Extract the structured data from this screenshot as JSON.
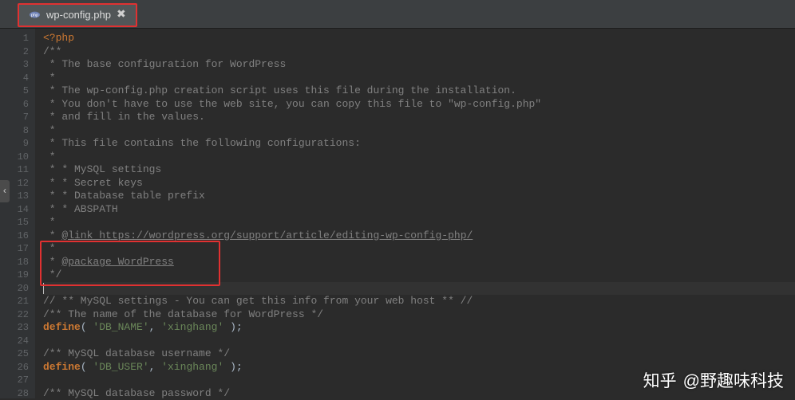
{
  "tab": {
    "filename": "wp-config.php",
    "close_glyph": "✖",
    "icon_name": "php-file-icon"
  },
  "lines": [
    {
      "n": 1,
      "segs": [
        {
          "t": "<?php",
          "cls": "c-tag"
        }
      ]
    },
    {
      "n": 2,
      "segs": [
        {
          "t": "/**",
          "cls": "c-comment"
        }
      ]
    },
    {
      "n": 3,
      "segs": [
        {
          "t": " * The base configuration for WordPress",
          "cls": "c-comment"
        }
      ]
    },
    {
      "n": 4,
      "segs": [
        {
          "t": " *",
          "cls": "c-comment"
        }
      ]
    },
    {
      "n": 5,
      "segs": [
        {
          "t": " * The wp-config.php creation script uses this file during the installation.",
          "cls": "c-comment"
        }
      ]
    },
    {
      "n": 6,
      "segs": [
        {
          "t": " * You don't have to use the web site, you can copy this file to \"wp-config.php\"",
          "cls": "c-comment"
        }
      ]
    },
    {
      "n": 7,
      "segs": [
        {
          "t": " * and fill in the values.",
          "cls": "c-comment"
        }
      ]
    },
    {
      "n": 8,
      "segs": [
        {
          "t": " *",
          "cls": "c-comment"
        }
      ]
    },
    {
      "n": 9,
      "segs": [
        {
          "t": " * This file contains the following configurations:",
          "cls": "c-comment"
        }
      ]
    },
    {
      "n": 10,
      "segs": [
        {
          "t": " *",
          "cls": "c-comment"
        }
      ]
    },
    {
      "n": 11,
      "segs": [
        {
          "t": " * * MySQL settings",
          "cls": "c-comment"
        }
      ]
    },
    {
      "n": 12,
      "segs": [
        {
          "t": " * * Secret keys",
          "cls": "c-comment"
        }
      ]
    },
    {
      "n": 13,
      "segs": [
        {
          "t": " * * Database table prefix",
          "cls": "c-comment"
        }
      ]
    },
    {
      "n": 14,
      "segs": [
        {
          "t": " * * ABSPATH",
          "cls": "c-comment"
        }
      ]
    },
    {
      "n": 15,
      "segs": [
        {
          "t": " *",
          "cls": "c-comment"
        }
      ]
    },
    {
      "n": 16,
      "segs": [
        {
          "t": " * ",
          "cls": "c-comment"
        },
        {
          "t": "@link https://wordpress.org/support/article/editing-wp-config-php/",
          "cls": "c-docline"
        }
      ]
    },
    {
      "n": 17,
      "segs": [
        {
          "t": " *",
          "cls": "c-comment"
        }
      ]
    },
    {
      "n": 18,
      "segs": [
        {
          "t": " * ",
          "cls": "c-comment"
        },
        {
          "t": "@package WordPress",
          "cls": "c-docline"
        }
      ]
    },
    {
      "n": 19,
      "segs": [
        {
          "t": " */",
          "cls": "c-comment"
        }
      ]
    },
    {
      "n": 20,
      "hl": true,
      "cursor": true,
      "segs": []
    },
    {
      "n": 21,
      "segs": [
        {
          "t": "// ** MySQL settings - You can get this info from your web host ** //",
          "cls": "c-comment"
        }
      ]
    },
    {
      "n": 22,
      "segs": [
        {
          "t": "/** The name of the database for WordPress */",
          "cls": "c-comment"
        }
      ]
    },
    {
      "n": 23,
      "segs": [
        {
          "t": "define",
          "cls": "c-keyword"
        },
        {
          "t": "( ",
          "cls": "c-plain"
        },
        {
          "t": "'DB_NAME'",
          "cls": "c-string"
        },
        {
          "t": ", ",
          "cls": "c-plain"
        },
        {
          "t": "'xinghang'",
          "cls": "c-string"
        },
        {
          "t": " );",
          "cls": "c-plain"
        }
      ]
    },
    {
      "n": 24,
      "segs": []
    },
    {
      "n": 25,
      "segs": [
        {
          "t": "/** MySQL database username */",
          "cls": "c-comment"
        }
      ]
    },
    {
      "n": 26,
      "segs": [
        {
          "t": "define",
          "cls": "c-keyword"
        },
        {
          "t": "( ",
          "cls": "c-plain"
        },
        {
          "t": "'DB_USER'",
          "cls": "c-string"
        },
        {
          "t": ", ",
          "cls": "c-plain"
        },
        {
          "t": "'xinghang'",
          "cls": "c-string"
        },
        {
          "t": " );",
          "cls": "c-plain"
        }
      ]
    },
    {
      "n": 27,
      "segs": []
    },
    {
      "n": 28,
      "segs": [
        {
          "t": "/** MySQL database password */",
          "cls": "c-comment"
        }
      ]
    }
  ],
  "watermark": {
    "brand": "知乎",
    "handle": "@野趣味科技"
  },
  "sidebar_chevron": "‹"
}
